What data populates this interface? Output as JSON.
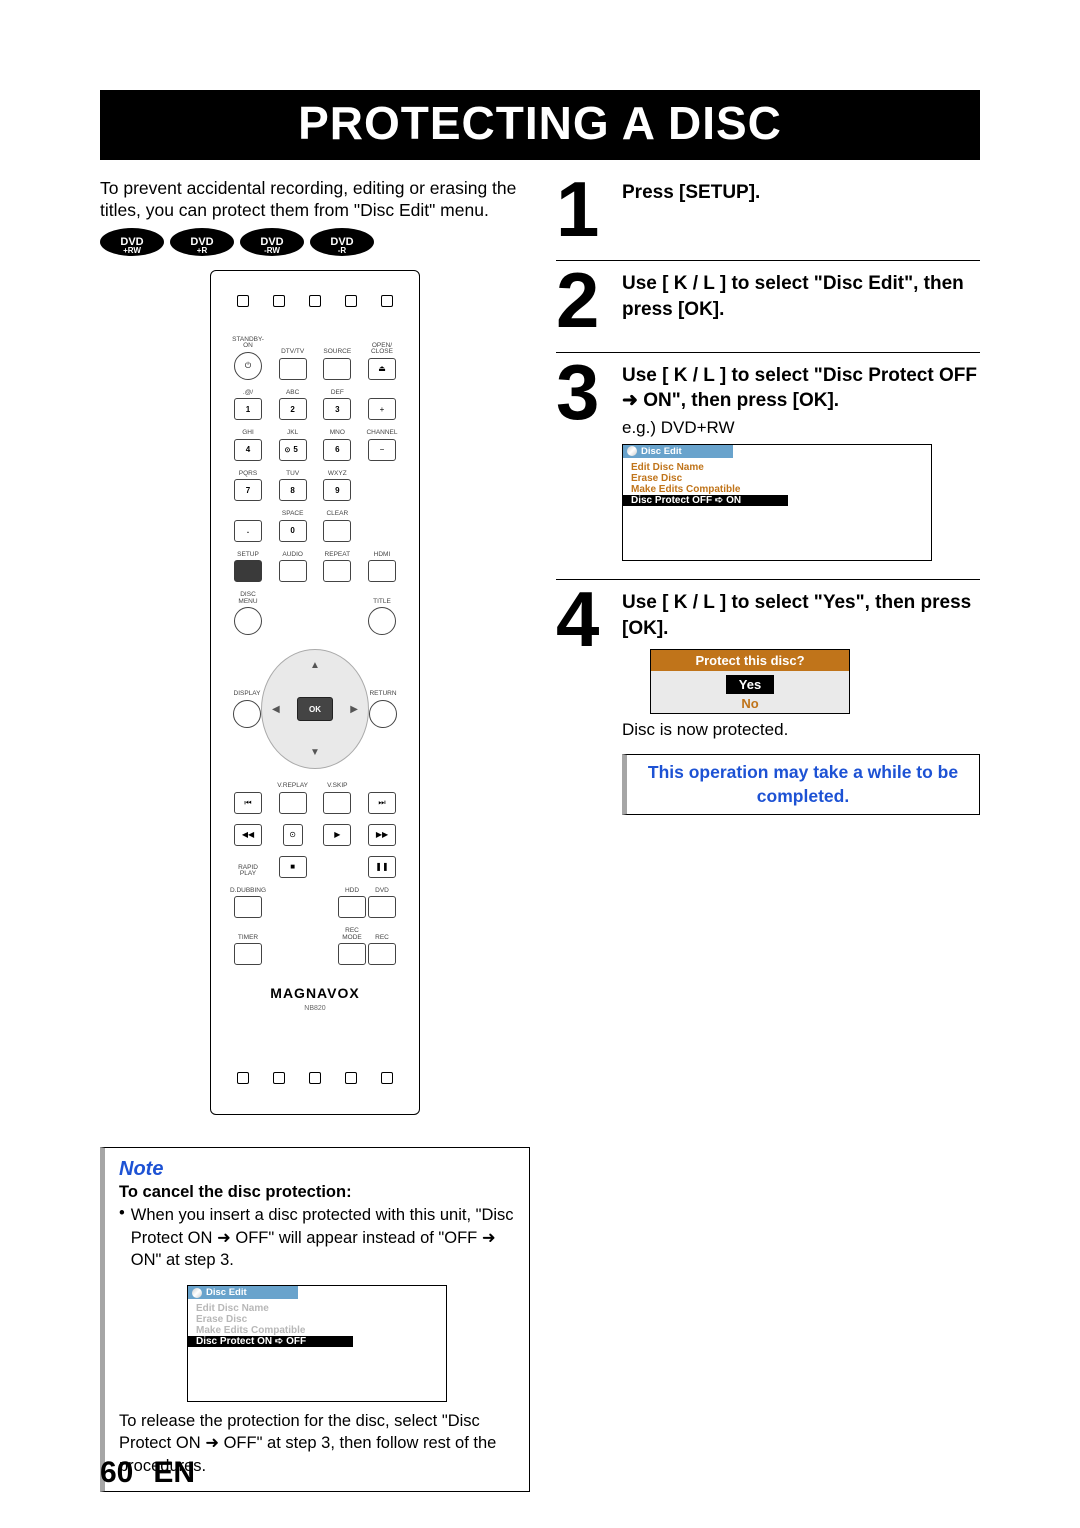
{
  "page_number": "60",
  "lang": "EN",
  "title": "PROTECTING A DISC",
  "intro": "To prevent accidental recording, editing or erasing the titles, you can protect them from \"Disc Edit\" menu.",
  "badges": [
    "DVD +RW",
    "DVD +R",
    "DVD -RW",
    "DVD -R"
  ],
  "remote": {
    "row1": [
      "STANDBY-ON",
      "DTV/TV",
      "SOURCE",
      "OPEN/ CLOSE"
    ],
    "numbers": {
      "r1_lab": [
        ".@/",
        "ABC",
        "DEF"
      ],
      "r1": [
        "1",
        "2",
        "3"
      ],
      "r2_lab": [
        "GHI",
        "JKL",
        "MNO"
      ],
      "r2": [
        "4",
        "5",
        "6"
      ],
      "r3_lab": [
        "PQRS",
        "TUV",
        "WXYZ"
      ],
      "r3": [
        "7",
        "8",
        "9"
      ],
      "r4_lab": [
        "",
        "SPACE",
        "CLEAR"
      ],
      "r4": [
        ".",
        "0",
        ""
      ]
    },
    "side_plus": "+",
    "side_minus": "−",
    "side_label": "CHANNEL",
    "row_setup": [
      "SETUP",
      "AUDIO",
      "REPEAT",
      "HDMI"
    ],
    "discmenu": "DISC MENU",
    "title_lbl": "TITLE",
    "display": "DISPLAY",
    "return": "RETURN",
    "ok": "OK",
    "vreplay": "V.REPLAY",
    "vskip": "V.SKIP",
    "rapid": "RAPID PLAY",
    "dub": "D.DUBBING",
    "hdd": "HDD",
    "dvd": "DVD",
    "timer": "TIMER",
    "recmode": "REC MODE",
    "rec": "REC",
    "brand": "MAGNAVOX",
    "model": "NB820"
  },
  "steps": {
    "s1": {
      "num": "1",
      "head": "Press [SETUP]."
    },
    "s2": {
      "num": "2",
      "head": "Use [ K / L ] to select \"Disc Edit\", then press [OK]."
    },
    "s3": {
      "num": "3",
      "head": "Use [ K / L ] to select \"Disc Protect OFF ➜ ON\", then press [OK].",
      "sub": "e.g.) DVD+RW",
      "menu_title": "Disc Edit",
      "items": [
        "Edit Disc Name",
        "Erase Disc",
        "Make Edits Compatible"
      ],
      "active": "Disc Protect OFF ➪ ON"
    },
    "s4": {
      "num": "4",
      "head": "Use [ K / L ] to select \"Yes\", then press [OK].",
      "dialog_head": "Protect this disc?",
      "opt_yes": "Yes",
      "opt_no": "No",
      "result": "Disc is now protected.",
      "highlight": "This operation may take a while to be completed."
    }
  },
  "note": {
    "title": "Note",
    "sub": "To cancel the disc protection:",
    "bullet": "When you insert a disc protected with this unit, \"Disc Protect ON ➜ OFF\" will appear instead of \"OFF ➜ ON\" at step 3.",
    "menu_title": "Disc Edit",
    "items": [
      "Edit Disc Name",
      "Erase Disc",
      "Make Edits Compatible"
    ],
    "active": "Disc Protect ON ➪ OFF",
    "after": "To release the protection for the disc, select \"Disc Protect ON ➜ OFF\" at step 3, then follow rest of the procedures."
  }
}
